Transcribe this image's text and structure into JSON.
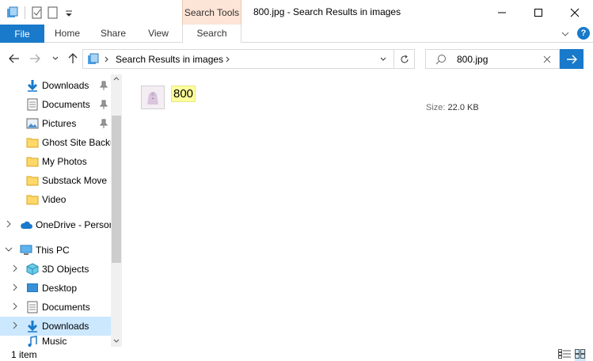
{
  "window": {
    "title": "800.jpg - Search Results in images",
    "contextual_tab": "Search Tools",
    "controls": [
      "minimize-icon",
      "maximize-icon",
      "close-icon"
    ]
  },
  "ribbon": {
    "tabs": [
      "File",
      "Home",
      "Share",
      "View",
      "Search"
    ]
  },
  "address": {
    "path": "Search Results in images",
    "search_value": "800.jpg"
  },
  "nav": {
    "quick_access": [
      {
        "label": "Downloads",
        "icon": "download-arrow-icon",
        "pinned": true
      },
      {
        "label": "Documents",
        "icon": "document-icon",
        "pinned": true
      },
      {
        "label": "Pictures",
        "icon": "pictures-icon",
        "pinned": true
      },
      {
        "label": "Ghost Site Backup",
        "icon": "folder-icon",
        "pinned": false
      },
      {
        "label": "My Photos",
        "icon": "folder-icon",
        "pinned": false
      },
      {
        "label": "Substack Move",
        "icon": "folder-icon",
        "pinned": false
      },
      {
        "label": "Video",
        "icon": "folder-icon",
        "pinned": false
      }
    ],
    "onedrive": "OneDrive - Personal",
    "this_pc": "This PC",
    "pc_items": [
      {
        "label": "3D Objects",
        "icon": "cube-icon",
        "selected": false
      },
      {
        "label": "Desktop",
        "icon": "desktop-icon",
        "selected": false
      },
      {
        "label": "Documents",
        "icon": "document-icon",
        "selected": false
      },
      {
        "label": "Downloads",
        "icon": "download-arrow-icon",
        "selected": true
      },
      {
        "label": "Music",
        "icon": "music-icon",
        "selected": false
      }
    ]
  },
  "result": {
    "name": "800",
    "size_label": "Size:",
    "size_value": "22.0 KB"
  },
  "status": {
    "count": "1 item"
  },
  "colors": {
    "accent": "#1979ca",
    "selection": "#cce8ff",
    "highlight": "#ffff9c",
    "context_tab": "#fce4d6"
  }
}
